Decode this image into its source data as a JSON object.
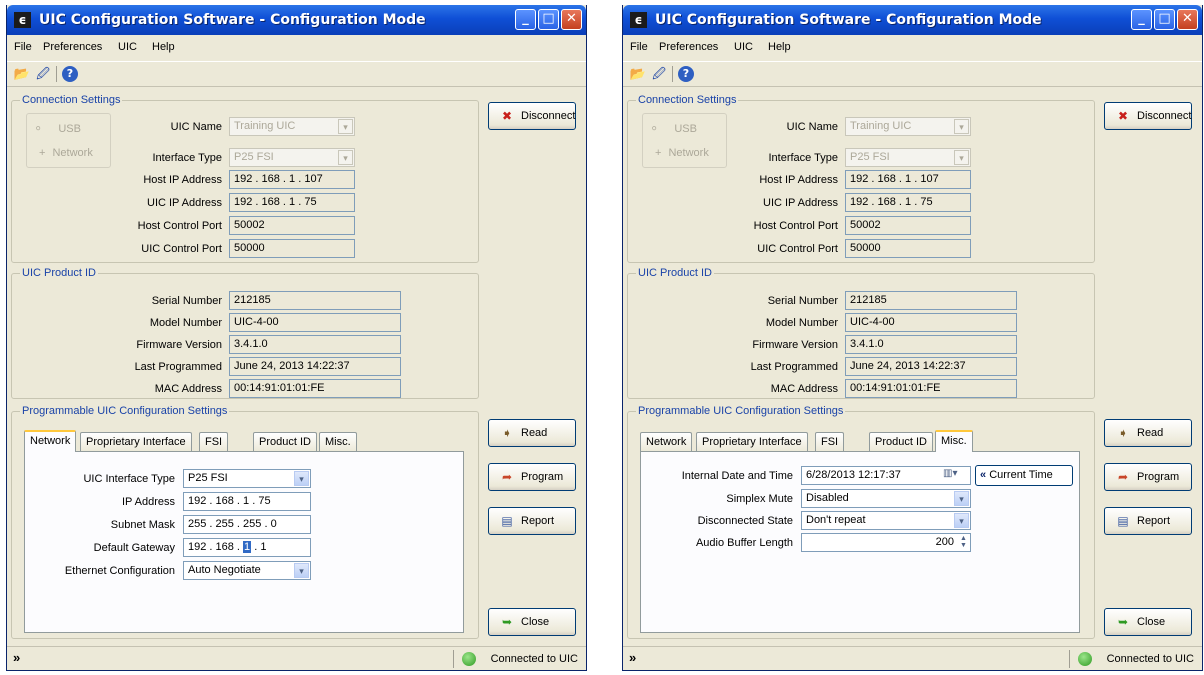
{
  "title": "UIC Configuration Software - Configuration Mode",
  "title_icon": "ϵ",
  "menu": [
    "File",
    "Preferences",
    "UIC",
    "Help"
  ],
  "connection": {
    "group_title": "Connection Settings",
    "usb": "USB",
    "network": "Network",
    "uic_name_label": "UIC Name",
    "uic_name_value": "Training UIC",
    "interface_type_label": "Interface Type",
    "interface_type_value": "P25 FSI",
    "host_ip_label": "Host IP Address",
    "host_ip_value": "192 . 168 .  1  . 107",
    "uic_ip_label": "UIC IP Address",
    "uic_ip_value": "192 . 168 .  1  .  75",
    "host_port_label": "Host Control Port",
    "host_port_value": "50002",
    "uic_port_label": "UIC Control Port",
    "uic_port_value": "50000"
  },
  "disconnect_label": "Disconnect",
  "product": {
    "group_title": "UIC Product ID",
    "serial_label": "Serial Number",
    "serial_value": "212185",
    "model_label": "Model Number",
    "model_value": "UIC-4-00",
    "firmware_label": "Firmware Version",
    "firmware_value": "3.4.1.0",
    "last_prog_label": "Last Programmed",
    "last_prog_value": "June 24, 2013  14:22:37",
    "mac_label": "MAC Address",
    "mac_value": "00:14:91:01:01:FE"
  },
  "prog": {
    "group_title": "Programmable UIC Configuration Settings",
    "tabs": [
      "Network",
      "Proprietary Interface",
      "FSI",
      "Product ID",
      "Misc."
    ]
  },
  "network_tab": {
    "iface_label": "UIC Interface Type",
    "iface_value": "P25 FSI",
    "ip_label": "IP Address",
    "ip_value": "192 . 168 .  1  .  75",
    "subnet_label": "Subnet Mask",
    "subnet_value": "255 . 255 . 255 .  0",
    "gateway_label": "Default Gateway",
    "gateway_a": "192 . 168 . ",
    "gateway_sel": "1",
    "gateway_b": " .  1",
    "eth_label": "Ethernet Configuration",
    "eth_value": "Auto Negotiate"
  },
  "misc_tab": {
    "date_label": "Internal Date and Time",
    "date_value": "6/28/2013  12:17:37",
    "current_time_btn": "Current Time",
    "simplex_label": "Simplex Mute",
    "simplex_value": "Disabled",
    "disc_label": "Disconnected State",
    "disc_value": "Don't repeat",
    "audio_label": "Audio Buffer Length",
    "audio_value": "200"
  },
  "buttons": {
    "read": "Read",
    "program": "Program",
    "report": "Report",
    "close": "Close"
  },
  "status": {
    "text": "Connected to UIC",
    "color": "#2f9a23"
  }
}
